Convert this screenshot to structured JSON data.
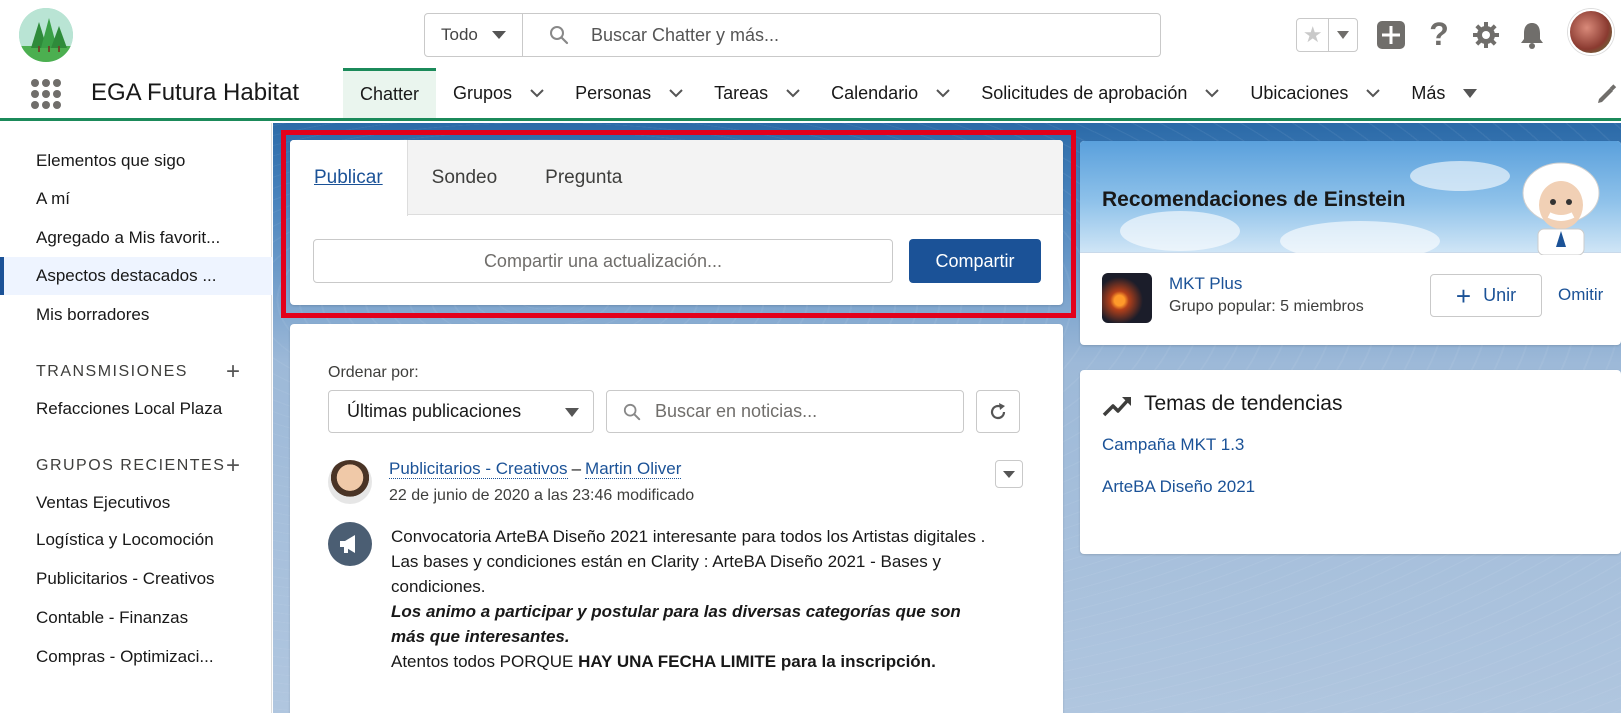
{
  "header": {
    "search_scope": "Todo",
    "search_placeholder": "Buscar Chatter y más..."
  },
  "nav": {
    "app_name": "EGA Futura Habitat",
    "tabs": [
      {
        "label": "Chatter"
      },
      {
        "label": "Grupos"
      },
      {
        "label": "Personas"
      },
      {
        "label": "Tareas"
      },
      {
        "label": "Calendario"
      },
      {
        "label": "Solicitudes de aprobación"
      },
      {
        "label": "Ubicaciones"
      },
      {
        "label": "Más"
      }
    ]
  },
  "sidebar": {
    "items": [
      {
        "label": "Elementos que sigo"
      },
      {
        "label": "A mí"
      },
      {
        "label": "Agregado a Mis favorit..."
      },
      {
        "label": "Aspectos destacados ..."
      },
      {
        "label": "Mis borradores"
      }
    ],
    "streams_heading": "TRANSMISIONES",
    "streams": [
      {
        "label": "Refacciones Local Plaza"
      }
    ],
    "groups_heading": "GRUPOS RECIENTES",
    "groups": [
      {
        "label": "Ventas Ejecutivos"
      },
      {
        "label": "Logística y Locomoción"
      },
      {
        "label": "Publicitarios - Creativos"
      },
      {
        "label": "Contable - Finanzas"
      },
      {
        "label": "Compras - Optimizaci..."
      }
    ]
  },
  "publisher": {
    "tabs": [
      {
        "label": "Publicar"
      },
      {
        "label": "Sondeo"
      },
      {
        "label": "Pregunta"
      }
    ],
    "input_placeholder": "Compartir una actualización...",
    "share_label": "Compartir"
  },
  "feed": {
    "sort_label": "Ordenar por:",
    "sort_value": "Últimas publicaciones",
    "search_placeholder": "Buscar en noticias...",
    "post": {
      "group": "Publicitarios - Creativos",
      "separator": "–",
      "author": "Martin Oliver",
      "date": "22 de junio de 2020 a las 23:46 modificado",
      "line1": "Convocatoria ArteBA Diseño 2021 interesante para todos los Artistas digitales .",
      "line2": "Las bases y condiciones están en Clarity : ArteBA Diseño 2021 - Bases y condiciones.",
      "line3": "Los animo a participar y postular para las diversas categorías que son más que interesantes.",
      "line4_prefix": "Atentos todos PORQUE ",
      "line4_bold": "HAY UNA FECHA LIMITE para la inscripción."
    }
  },
  "einstein": {
    "title": "Recomendaciones de Einstein",
    "rec_name": "MKT Plus",
    "rec_sub": "Grupo popular: 5 miembros",
    "join_label": "Unir",
    "omit_label": "Omitir"
  },
  "trending": {
    "title": "Temas de tendencias",
    "topics": [
      {
        "label": "Campaña MKT 1.3"
      },
      {
        "label": "ArteBA Diseño 2021"
      }
    ]
  },
  "colors": {
    "brand_blue": "#1b5297",
    "nav_accent": "#1b8a5a",
    "highlight_border": "#e3001b"
  }
}
